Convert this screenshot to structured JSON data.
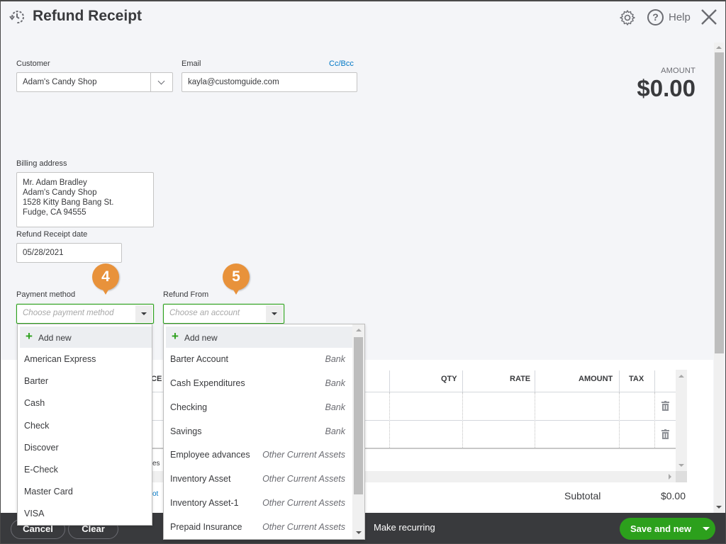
{
  "header": {
    "title": "Refund Receipt",
    "help_label": "Help",
    "icons": [
      "recent-transactions-icon",
      "gear-icon",
      "help-icon",
      "close-icon"
    ]
  },
  "amount": {
    "label": "AMOUNT",
    "value": "$0.00"
  },
  "customer": {
    "label": "Customer",
    "value": "Adam's Candy Shop"
  },
  "email": {
    "label": "Email",
    "value": "kayla@customguide.com",
    "cc_bcc": "Cc/Bcc"
  },
  "billing": {
    "label": "Billing address",
    "lines": [
      "Mr. Adam Bradley",
      "Adam's Candy Shop",
      "1528 Kitty Bang Bang St.",
      "Fudge, CA  94555"
    ]
  },
  "refund_date": {
    "label": "Refund Receipt date",
    "value": "05/28/2021"
  },
  "payment_method": {
    "label": "Payment method",
    "placeholder": "Choose payment method",
    "callout": "4",
    "add_new": "Add new",
    "options": [
      "American Express",
      "Barter",
      "Cash",
      "Check",
      "Discover",
      "E-Check",
      "Master Card",
      "VISA"
    ]
  },
  "refund_from": {
    "label": "Refund From",
    "placeholder": "Choose an account",
    "callout": "5",
    "add_new": "Add new",
    "options": [
      {
        "name": "Barter Account",
        "type": "Bank"
      },
      {
        "name": "Cash Expenditures",
        "type": "Bank"
      },
      {
        "name": "Checking",
        "type": "Bank"
      },
      {
        "name": "Savings",
        "type": "Bank"
      },
      {
        "name": "Employee advances",
        "type": "Other Current Assets"
      },
      {
        "name": "Inventory Asset",
        "type": "Other Current Assets"
      },
      {
        "name": "Inventory Asset-1",
        "type": "Other Current Assets"
      },
      {
        "name": "Prepaid Insurance",
        "type": "Other Current Assets"
      }
    ]
  },
  "table": {
    "columns": {
      "partial": "CE",
      "qty": "QTY",
      "rate": "RATE",
      "amount": "AMOUNT",
      "tax": "TAX"
    },
    "rows": [
      {
        "qty": "",
        "rate": "",
        "amount": "",
        "tax": ""
      },
      {
        "qty": "",
        "rate": "",
        "amount": "",
        "tax": ""
      }
    ],
    "partial_texts": [
      "es",
      "ot"
    ]
  },
  "subtotal": {
    "label": "Subtotal",
    "value": "$0.00"
  },
  "footer": {
    "cancel": "Cancel",
    "clear": "Clear",
    "make_recurring": "Make recurring",
    "save_and_new": "Save and new"
  },
  "colors": {
    "accent_green": "#2ca01c",
    "link_blue": "#0077c5",
    "callout_orange": "#e8923b",
    "footer_bg": "#393a3d"
  }
}
